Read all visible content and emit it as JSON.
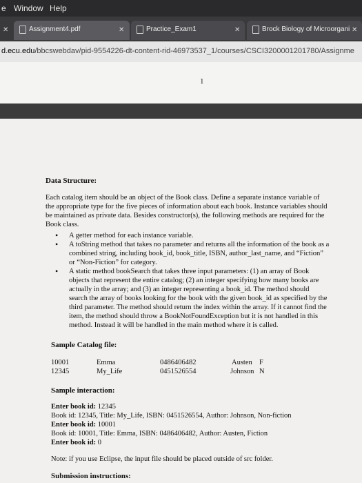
{
  "menubar": {
    "items": [
      "e",
      "Window",
      "Help"
    ]
  },
  "tabs": [
    {
      "label": "Assignment4.pdf"
    },
    {
      "label": "Practice_Exam1"
    },
    {
      "label": "Brock Biology of Microorgani..."
    }
  ],
  "address": {
    "host": "d.ecu.edu",
    "path": "/bbcswebdav/pid-9554226-dt-content-rid-46973537_1/courses/CSCI3200001201780/Assignme"
  },
  "pdf": {
    "page_number": "1",
    "data_structure_heading": "Data Structure:",
    "intro_lines": [
      "Each catalog item should be an object of the Book class. Define a separate instance variable of",
      "the appropriate type for the five pieces of information about each book. Instance variables should",
      "be maintained as private data. Besides constructor(s), the following methods are required for the",
      "Book class."
    ],
    "bullets": [
      [
        "A getter method for each instance variable."
      ],
      [
        "A toString method that takes no parameter and returns all the information of the book as a",
        "combined string, including book_id, book_title, ISBN, author_last_name, and “Fiction”",
        "or “Non-Fiction” for category."
      ],
      [
        "A static method bookSearch that takes three input parameters: (1) an array of Book",
        "objects that represent the entire catalog; (2) an integer specifying how many books are",
        "actually in the array; and (3) an integer representing a book_id. The method should",
        "search the array of books looking for the book with the given book_id as specified by the",
        "third parameter. The method should return the index within the array. If it cannot find the",
        "item, the method should throw a BookNotFoundException but it is not handled in this",
        "method. Instead it will be handled in the main method where it is called."
      ]
    ],
    "sample_catalog_heading": "Sample Catalog file:",
    "catalog": [
      {
        "id": "10001",
        "title": "Emma",
        "isbn": "0486406482",
        "author": "Austen",
        "cat": "F"
      },
      {
        "id": "12345",
        "title": "My_Life",
        "isbn": "0451526554",
        "author": "Johnson",
        "cat": "N"
      }
    ],
    "sample_interaction_heading": "Sample interaction:",
    "interaction": [
      {
        "label": "Enter book id:",
        "value": " 12345"
      },
      {
        "label": "",
        "value": "Book id: 12345, Title: My_Life, ISBN: 0451526554, Author: Johnson, Non-fiction"
      },
      {
        "label": "Enter book id:",
        "value": " 10001"
      },
      {
        "label": "",
        "value": "Book id: 10001, Title: Emma, ISBN: 0486406482, Author: Austen, Fiction"
      },
      {
        "label": "Enter book id:",
        "value": " 0"
      }
    ],
    "note": "Note: if you use Eclipse, the input file should be placed outside of src folder.",
    "submission_heading": "Submission instructions:"
  }
}
